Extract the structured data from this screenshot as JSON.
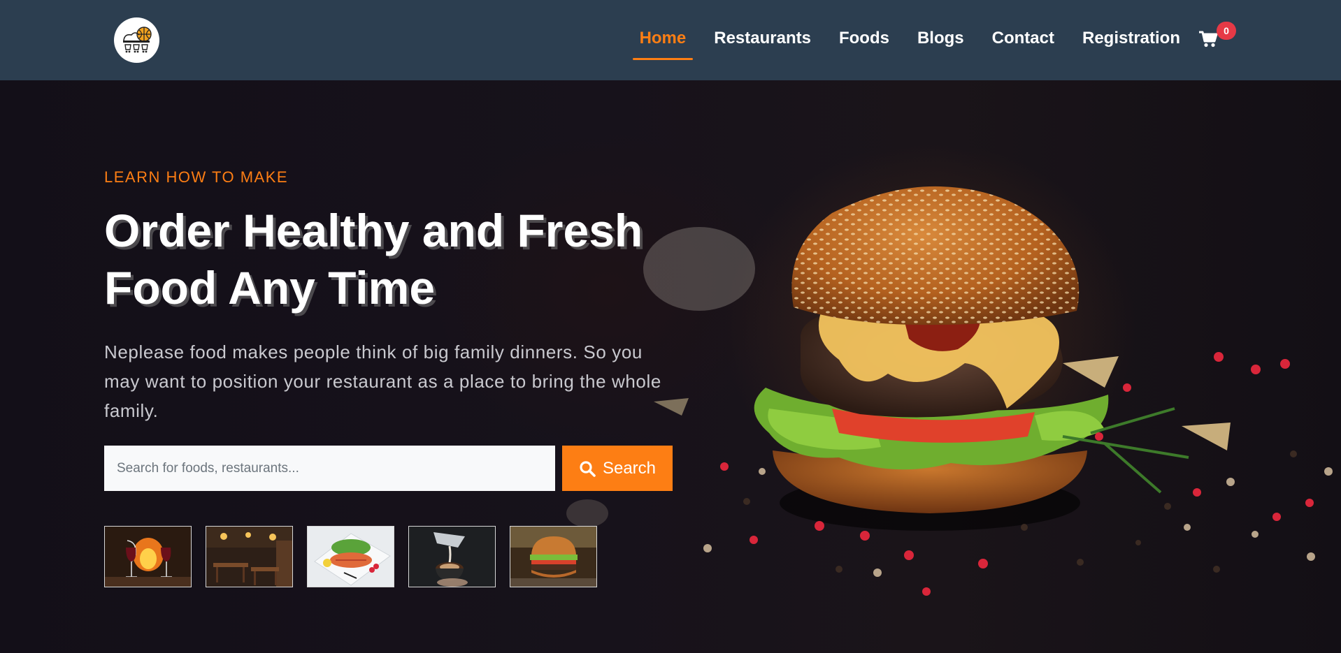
{
  "nav": {
    "links": [
      {
        "label": "Home",
        "active": true
      },
      {
        "label": "Restaurants"
      },
      {
        "label": "Foods"
      },
      {
        "label": "Blogs"
      },
      {
        "label": "Contact"
      },
      {
        "label": "Registration"
      }
    ],
    "cart_count": "0"
  },
  "hero": {
    "kicker": "LEARN HOW TO MAKE",
    "title_line1": "Order Healthy and Fresh",
    "title_line2": "Food Any Time",
    "description": "Neplease food makes people think of big family dinners. So you may want to position your restaurant as a place to bring the whole family.",
    "search_placeholder": "Search for foods, restaurants...",
    "search_button": "Search"
  },
  "colors": {
    "navbar": "#2c3e50",
    "accent": "#fd7e14",
    "badge": "#e63946"
  },
  "icons": [
    "cart-icon",
    "search-icon"
  ]
}
